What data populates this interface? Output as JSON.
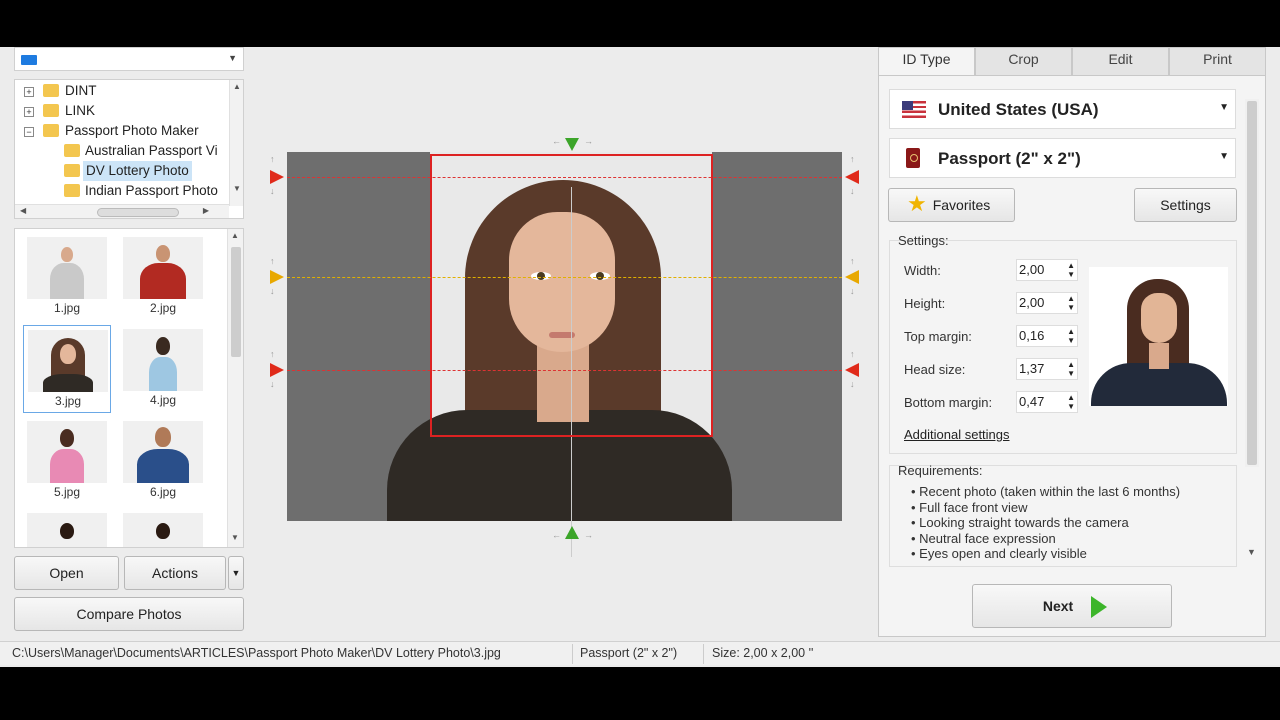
{
  "tree": {
    "items": [
      {
        "label": "DINT",
        "expander": "+"
      },
      {
        "label": "LINK",
        "expander": "+"
      },
      {
        "label": "Passport Photo Maker",
        "expander": "−"
      },
      {
        "label": "Australian Passport Vi"
      },
      {
        "label": "DV Lottery Photo"
      },
      {
        "label": "Indian Passport Photo"
      }
    ]
  },
  "thumbnails": [
    {
      "label": "1.jpg"
    },
    {
      "label": "2.jpg"
    },
    {
      "label": "3.jpg"
    },
    {
      "label": "4.jpg"
    },
    {
      "label": "5.jpg"
    },
    {
      "label": "6.jpg"
    }
  ],
  "buttons": {
    "open": "Open",
    "actions": "Actions",
    "compare": "Compare Photos",
    "favorites": "Favorites",
    "settings": "Settings",
    "next": "Next"
  },
  "tabs": [
    {
      "label": "ID Type",
      "active": true
    },
    {
      "label": "Crop"
    },
    {
      "label": "Edit"
    },
    {
      "label": "Print"
    }
  ],
  "country": {
    "value": "United States (USA)"
  },
  "document": {
    "value": "Passport (2\" x 2\")"
  },
  "settings": {
    "title": "Settings:",
    "fields": [
      {
        "label": "Width:",
        "value": "2,00"
      },
      {
        "label": "Height:",
        "value": "2,00"
      },
      {
        "label": "Top margin:",
        "value": "0,16"
      },
      {
        "label": "Head size:",
        "value": "1,37"
      },
      {
        "label": "Bottom margin:",
        "value": "0,47"
      }
    ],
    "additional": "Additional settings"
  },
  "requirements": {
    "title": "Requirements:",
    "items": [
      "Recent photo (taken within the last 6 months)",
      "Full face front view",
      "Looking straight towards the camera",
      "Neutral face expression",
      "Eyes open and clearly visible"
    ]
  },
  "status": {
    "path": "C:\\Users\\Manager\\Documents\\ARTICLES\\Passport Photo Maker\\DV Lottery Photo\\3.jpg",
    "format": "Passport (2\" x 2\")",
    "size": "Size: 2,00 x 2,00 ''"
  },
  "colors": {
    "guide_red": "#d22",
    "guide_yellow": "#e0b000",
    "arrow_green": "#3ca52a"
  }
}
